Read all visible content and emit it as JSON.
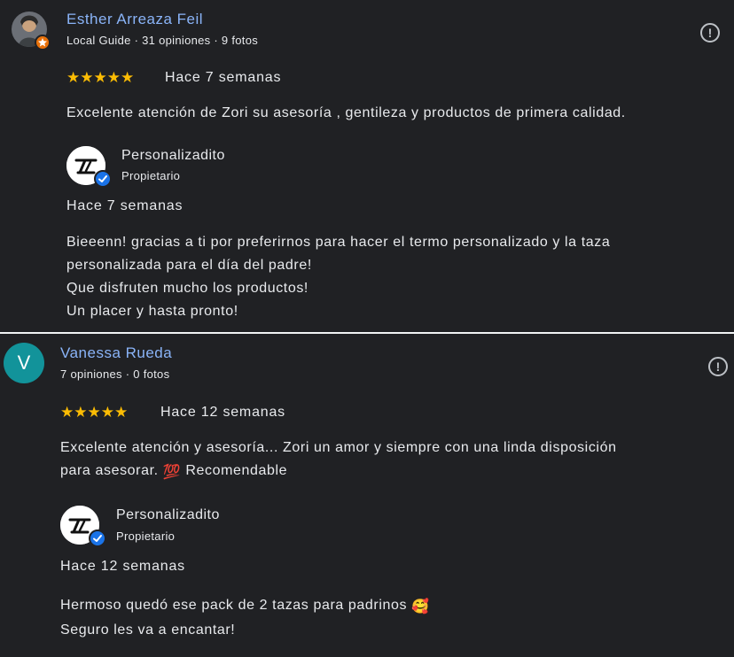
{
  "reviews": [
    {
      "author": "Esther Arreaza Feil",
      "meta": "Local Guide · 31 opiniones · 9 fotos",
      "rating": 5,
      "stars": "★★★★★",
      "time": "Hace 7 semanas",
      "text": "Excelente atención de Zori su asesoría , gentileza y productos de primera calidad.",
      "reply": {
        "owner": "Personalizadito",
        "role": "Propietario",
        "time": "Hace 7 semanas",
        "lines": [
          "Bieeenn! gracias a ti por preferirnos para hacer el termo personalizado y la taza",
          "personalizada para el día del padre!",
          "Que disfruten mucho los productos!",
          "Un placer y hasta pronto!"
        ]
      }
    },
    {
      "author": "Vanessa Rueda",
      "avatar_letter": "V",
      "meta": "7 opiniones · 0 fotos",
      "rating": 5,
      "stars": "★★★★★",
      "time": "Hace 12 semanas",
      "text_lines": [
        "Excelente atención y asesoría... Zori un amor y siempre con una linda disposición",
        "para asesorar.",
        "Recomendable"
      ],
      "text_emoji": "💯",
      "reply": {
        "owner": "Personalizadito",
        "role": "Propietario",
        "time": "Hace 12 semanas",
        "lines": [
          "Hermoso quedó ese pack de 2 tazas para padrinos",
          "Seguro les va a encantar!"
        ],
        "emoji": "🥰"
      }
    }
  ],
  "icons": {
    "flag": "report-flag-icon",
    "verified": "verified-check-icon",
    "star": "star-icon"
  },
  "colors": {
    "background": "#202124",
    "author_link": "#8ab4f8",
    "star": "#fbbc04",
    "verified": "#1a73e8",
    "avatar_teal": "#12939a",
    "local_guide_badge": "#e8710a"
  }
}
